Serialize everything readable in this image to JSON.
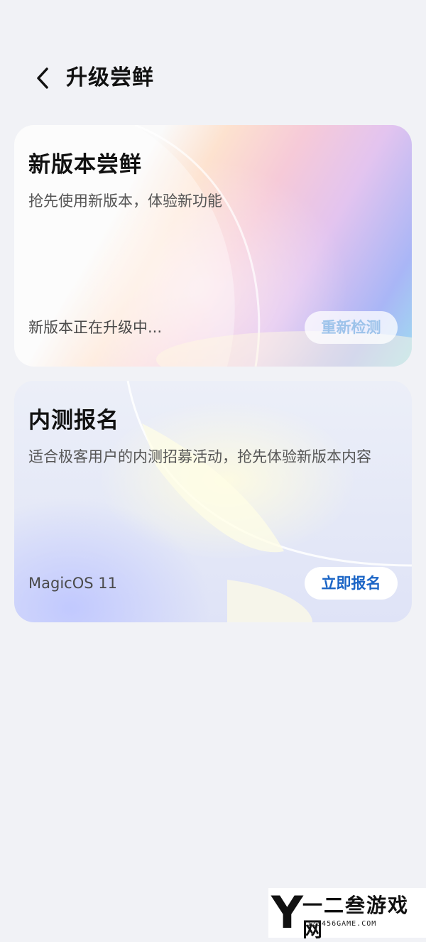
{
  "header": {
    "title": "升级尝鲜",
    "back_icon": "chevron-left-icon"
  },
  "cards": [
    {
      "title": "新版本尝鲜",
      "description": "抢先使用新版本，体验新功能",
      "status": "新版本正在升级中...",
      "button_label": "重新检测"
    },
    {
      "title": "内测报名",
      "description": "适合极客用户的内测招募活动，抢先体验新版本内容",
      "status": "MagicOS 11",
      "button_label": "立即报名"
    }
  ],
  "watermark": {
    "logo_letter": "Y",
    "name": "一二叁游戏网",
    "site": "123456GAME.COM"
  },
  "colors": {
    "background": "#f1f2f6",
    "accent": "#1b65c6",
    "disabled_button_text": "#9dc3ea"
  }
}
